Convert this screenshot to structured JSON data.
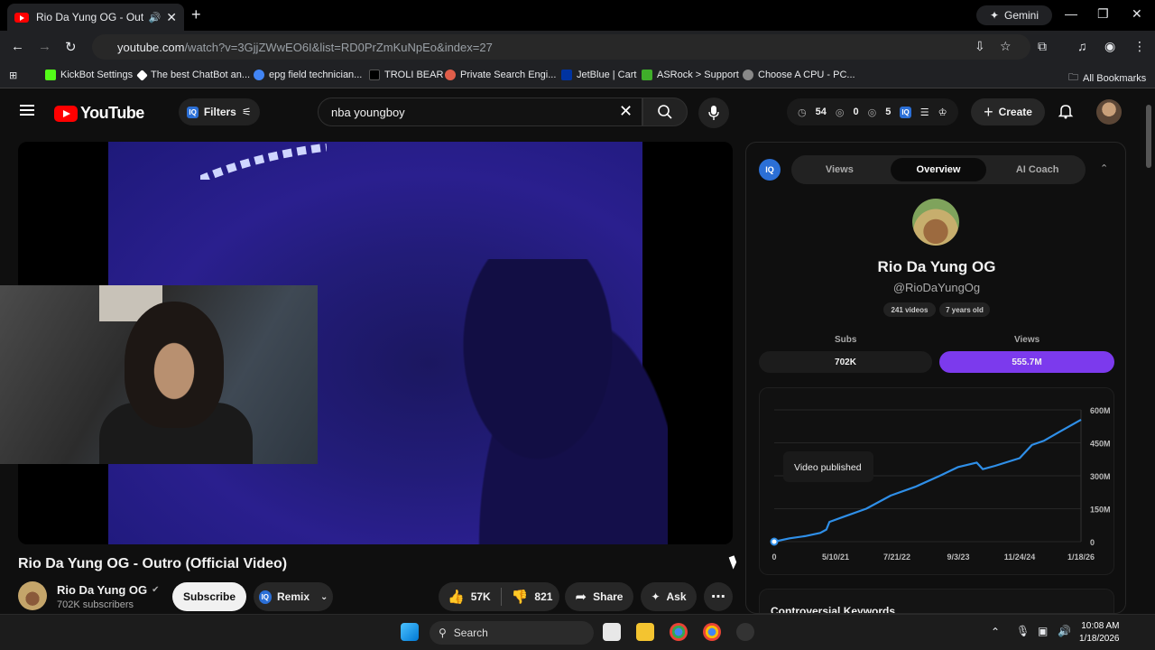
{
  "browser": {
    "tab_title": "Rio Da Yung OG - Outro (O",
    "new_tab": "+",
    "gemini_label": "Gemini",
    "url_host": "youtube.com",
    "url_path": "/watch?v=3GjjZWwEO6I&list=RD0PrZmKuNpEo&index=27",
    "bookmarks": [
      {
        "label": "KickBot Settings",
        "color": "#53fc18"
      },
      {
        "label": "The best ChatBot an...",
        "color": "#ffffff"
      },
      {
        "label": "epg field technician...",
        "color": "#4285f4"
      },
      {
        "label": "TROLI BEAR",
        "color": "#000000"
      },
      {
        "label": "Private Search Engi...",
        "color": "#e05e4a"
      },
      {
        "label": "JetBlue | Cart",
        "color": "#0033a0"
      },
      {
        "label": "ASRock > Support",
        "color": "#3fae2a"
      },
      {
        "label": "Choose A CPU - PC...",
        "color": "#888888"
      }
    ],
    "all_bookmarks": "All Bookmarks"
  },
  "youtube": {
    "logo_text": "YouTube",
    "filters_label": "Filters",
    "iq_badge": "IQ",
    "search_value": "nba youngboy",
    "stats": {
      "a": "54",
      "b": "0",
      "c": "5"
    },
    "create_label": "Create"
  },
  "video": {
    "title": "Rio Da Yung OG - Outro (Official Video)",
    "channel": "Rio Da Yung OG",
    "subscribers": "702K subscribers",
    "subscribe_label": "Subscribe",
    "remix_label": "Remix",
    "likes": "57K",
    "dislikes": "821",
    "share_label": "Share",
    "ask_label": "Ask"
  },
  "panel": {
    "tabs": [
      "Views",
      "Overview",
      "AI Coach"
    ],
    "channel_name": "Rio Da Yung OG",
    "handle": "@RioDaYungOg",
    "videos_chip": "241 videos",
    "age_chip": "7 years old",
    "subs_label": "Subs",
    "views_label": "Views",
    "subs_value": "702K",
    "views_value": "555.7M",
    "tooltip": "Video published",
    "controversial": "Controversial Keywords"
  },
  "chart_data": {
    "type": "line",
    "x_ticks": [
      "0",
      "5/10/21",
      "7/21/22",
      "9/3/23",
      "11/24/24",
      "1/18/26"
    ],
    "y_ticks": [
      "0",
      "150M",
      "300M",
      "450M",
      "600M"
    ],
    "ylim": [
      0,
      600
    ],
    "series": [
      {
        "color": "#2f8fe8",
        "points": [
          [
            0,
            0
          ],
          [
            0.05,
            15
          ],
          [
            0.1,
            25
          ],
          [
            0.15,
            40
          ],
          [
            0.17,
            55
          ],
          [
            0.18,
            90
          ],
          [
            0.22,
            110
          ],
          [
            0.3,
            150
          ],
          [
            0.38,
            210
          ],
          [
            0.46,
            250
          ],
          [
            0.54,
            300
          ],
          [
            0.6,
            340
          ],
          [
            0.66,
            360
          ],
          [
            0.68,
            330
          ],
          [
            0.72,
            345
          ],
          [
            0.8,
            380
          ],
          [
            0.84,
            440
          ],
          [
            0.88,
            460
          ],
          [
            0.93,
            500
          ],
          [
            1.0,
            555
          ]
        ]
      }
    ]
  },
  "taskbar": {
    "search_label": "Search",
    "time": "10:08 AM",
    "date": "1/18/2026"
  }
}
